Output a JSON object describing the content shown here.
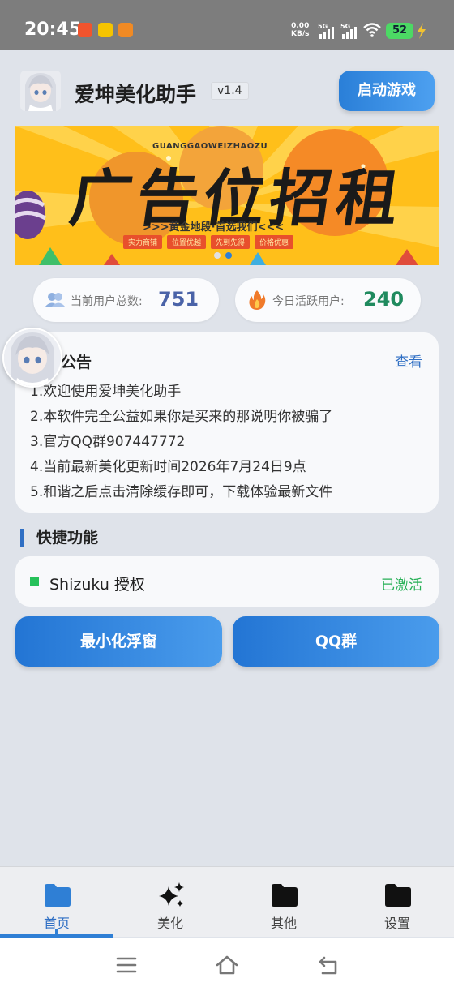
{
  "status_bar": {
    "time": "20:45",
    "net_speed_value": "0.00",
    "net_speed_unit": "KB/s",
    "signal_1": "5G",
    "signal_2": "5G",
    "battery": "52"
  },
  "header": {
    "app_name": "爱坤美化助手",
    "version": "v1.4",
    "start_button": "启动游戏"
  },
  "banner": {
    "top_text": "GUANGGAOWEIZHAOZU",
    "main_text": "广告位招租",
    "sub_text": ">>>黄金地段·首选我们<<<",
    "tags": [
      "实力商铺",
      "位置优越",
      "先到先得",
      "价格优惠"
    ],
    "slide_count": 2,
    "active_slide": 2
  },
  "stats": {
    "total_label": "当前用户总数:",
    "total_value": "751",
    "active_label": "今日活跃用户:",
    "active_value": "240",
    "total_icon": "users-icon",
    "active_icon": "fire-icon"
  },
  "notice": {
    "title": "公告",
    "view": "查看",
    "lines": [
      "1.欢迎使用爱坤美化助手",
      "2.本软件完全公益如果你是买来的那说明你被骗了",
      "3.官方QQ群907447772",
      "4.当前最新美化更新时间2026年7月24日9点",
      "5.和谐之后点击清除缓存即可，下载体验最新文件"
    ]
  },
  "quick": {
    "title": "快捷功能",
    "shizuku_label": "Shizuku 授权",
    "shizuku_status": "已激活",
    "btn_minimize": "最小化浮窗",
    "btn_qq": "QQ群"
  },
  "nav": {
    "items": [
      {
        "label": "首页",
        "icon": "folder-icon"
      },
      {
        "label": "美化",
        "icon": "sparkle-icon"
      },
      {
        "label": "其他",
        "icon": "folder-icon"
      },
      {
        "label": "设置",
        "icon": "folder-icon"
      }
    ]
  },
  "colors": {
    "accent": "#2f7fd5",
    "total_value": "#4a63a8",
    "active_value": "#1f8a5e",
    "status_ok": "#27b056"
  }
}
